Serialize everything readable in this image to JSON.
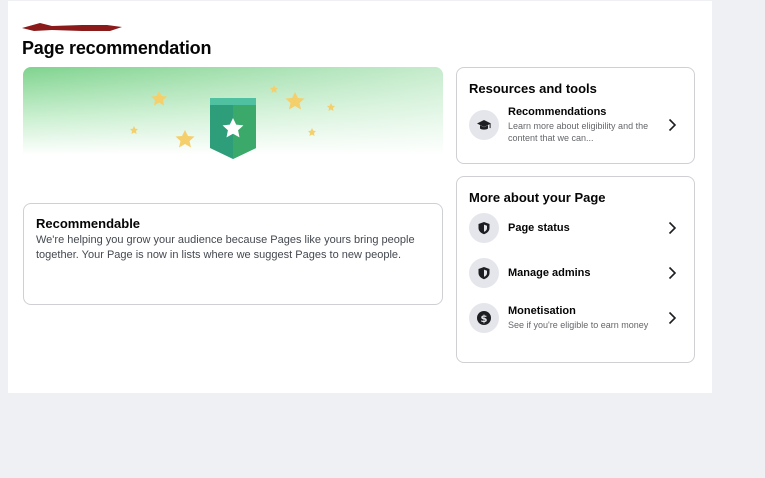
{
  "page_title": "Page recommendation",
  "hero": {
    "icon": "shield-star-badge",
    "accent": "#2fa36b"
  },
  "recommendable": {
    "title": "Recommendable",
    "body": "We're helping you grow your audience because Pages like yours bring people together. Your Page is now in lists where we suggest Pages to new people."
  },
  "resources": {
    "title": "Resources and tools",
    "items": [
      {
        "label": "Recommendations",
        "sub": "Learn more about eligibility and the content that we can...",
        "icon": "graduation-cap-icon"
      }
    ]
  },
  "more": {
    "title": "More about your Page",
    "items": [
      {
        "label": "Page status",
        "sub": "",
        "icon": "shield-icon"
      },
      {
        "label": "Manage admins",
        "sub": "",
        "icon": "shield-icon"
      },
      {
        "label": "Monetisation",
        "sub": "See if you're eligible to earn money",
        "icon": "dollar-icon"
      }
    ]
  },
  "colors": {
    "background": "#eef0f4",
    "card_border": "#ced0d4",
    "icon_bg": "#e4e6eb",
    "redaction": "#8b1a1a"
  }
}
